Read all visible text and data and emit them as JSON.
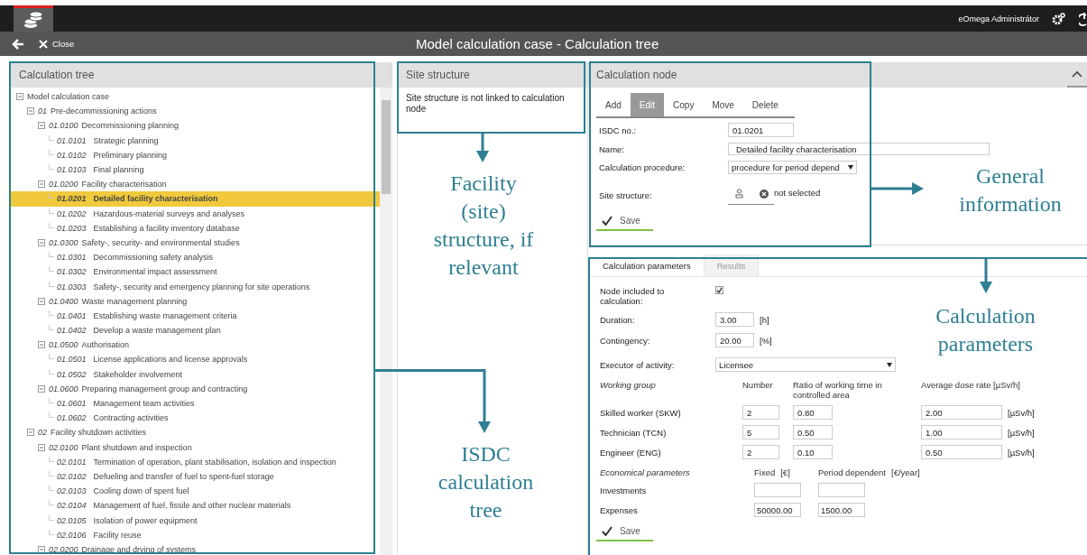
{
  "top_bar": {
    "user": "eOmega Administrátor"
  },
  "sub_bar": {
    "close": "Close",
    "title": "Model calculation case - Calculation tree"
  },
  "tree_panel": {
    "title": "Calculation tree",
    "root": {
      "label": "Model calculation case",
      "expanded": true,
      "selected": false,
      "children": [
        {
          "code": "01",
          "label": "Pre-decommissioning actions",
          "expanded": true,
          "selected": false,
          "children": [
            {
              "code": "01.0100",
              "label": "Decommissioning planning",
              "expanded": true,
              "selected": false,
              "children": [
                {
                  "code": "01.0101",
                  "label": "Strategic planning",
                  "selected": false
                },
                {
                  "code": "01.0102",
                  "label": "Preliminary planning",
                  "selected": false
                },
                {
                  "code": "01.0103",
                  "label": "Final planning",
                  "selected": false
                }
              ]
            },
            {
              "code": "01.0200",
              "label": "Facility characterisation",
              "expanded": true,
              "selected": false,
              "children": [
                {
                  "code": "01.0201",
                  "label": "Detailed facility characterisation",
                  "selected": true
                },
                {
                  "code": "01.0202",
                  "label": "Hazardous-material surveys and analyses",
                  "selected": false
                },
                {
                  "code": "01.0203",
                  "label": "Establishing a facility inventory database",
                  "selected": false
                }
              ]
            },
            {
              "code": "01.0300",
              "label": "Safety-, security- and environmental studies",
              "expanded": true,
              "selected": false,
              "children": [
                {
                  "code": "01.0301",
                  "label": "Decommissioning safety analysis",
                  "selected": false
                },
                {
                  "code": "01.0302",
                  "label": "Environmental impact assessment",
                  "selected": false
                },
                {
                  "code": "01.0303",
                  "label": "Safety-, security and emergency planning for site operations",
                  "selected": false
                }
              ]
            },
            {
              "code": "01.0400",
              "label": "Waste management planning",
              "expanded": true,
              "selected": false,
              "children": [
                {
                  "code": "01.0401",
                  "label": "Establishing waste management criteria",
                  "selected": false
                },
                {
                  "code": "01.0402",
                  "label": "Develop a waste management plan",
                  "selected": false
                }
              ]
            },
            {
              "code": "01.0500",
              "label": "Authorisation",
              "expanded": true,
              "selected": false,
              "children": [
                {
                  "code": "01.0501",
                  "label": "License applications and license approvals",
                  "selected": false
                },
                {
                  "code": "01.0502",
                  "label": "Stakeholder involvement",
                  "selected": false
                }
              ]
            },
            {
              "code": "01.0600",
              "label": "Preparing management group and contracting",
              "expanded": true,
              "selected": false,
              "children": [
                {
                  "code": "01.0601",
                  "label": "Management team activities",
                  "selected": false
                },
                {
                  "code": "01.0602",
                  "label": "Contracting activities",
                  "selected": false
                }
              ]
            }
          ]
        },
        {
          "code": "02",
          "label": "Facility shutdown activities",
          "expanded": true,
          "selected": false,
          "children": [
            {
              "code": "02.0100",
              "label": "Plant shutdown and inspection",
              "expanded": true,
              "selected": false,
              "children": [
                {
                  "code": "02.0101",
                  "label": "Termination of operation, plant stabilisation, isolation and inspection",
                  "selected": false
                },
                {
                  "code": "02.0102",
                  "label": "Defueling and transfer of fuel to spent-fuel storage",
                  "selected": false
                },
                {
                  "code": "02.0103",
                  "label": "Cooling down of spent fuel",
                  "selected": false
                },
                {
                  "code": "02.0104",
                  "label": "Management of fuel, fissile and other nuclear materials",
                  "selected": false
                },
                {
                  "code": "02.0105",
                  "label": "Isolation of power equipment",
                  "selected": false
                },
                {
                  "code": "02.0106",
                  "label": "Facility reuse",
                  "selected": false
                }
              ]
            },
            {
              "code": "02.0200",
              "label": "Drainage and drying of systems",
              "expanded": true,
              "selected": false
            }
          ]
        }
      ]
    }
  },
  "site_panel": {
    "title": "Site structure",
    "message": "Site structure is not linked to calculation node"
  },
  "node_panel": {
    "title": "Calculation node",
    "tabs": [
      {
        "label": "Add",
        "selected": false
      },
      {
        "label": "Edit",
        "selected": true
      },
      {
        "label": "Copy",
        "selected": false
      },
      {
        "label": "Move",
        "selected": false
      },
      {
        "label": "Delete",
        "selected": false
      }
    ],
    "isdc": {
      "label": "ISDC no.:",
      "value": "01.0201"
    },
    "name": {
      "label": "Name:",
      "value": "Detailed facility characterisation"
    },
    "procedure": {
      "label": "Calculation procedure:",
      "value": "procedure for period depend"
    },
    "site_structure": {
      "label": "Site structure:",
      "value": "not selected"
    },
    "save": "Save"
  },
  "params_panel": {
    "tabs": [
      {
        "label": "Calculation parameters",
        "selected": true
      },
      {
        "label": "Results",
        "selected": false
      }
    ],
    "included": {
      "label": "Node included to calculation:",
      "checked": true
    },
    "duration": {
      "label": "Duration:",
      "value": "3.00",
      "unit": "[h]"
    },
    "contingency": {
      "label": "Contingency:",
      "value": "20.00",
      "unit": "[%]"
    },
    "executor": {
      "label": "Executor of activity:",
      "value": "Licensee"
    },
    "working_group": {
      "columns": [
        "Working group",
        "Number",
        "Ratio of working time in controlled area",
        "Average dose rate [µSv/h]"
      ],
      "rows": [
        {
          "label": "Skilled worker (SKW)",
          "number": "2",
          "ratio": "0.80",
          "dose": "2.00",
          "unit": "[µSv/h]"
        },
        {
          "label": "Technician (TCN)",
          "number": "5",
          "ratio": "0.50",
          "dose": "1.00",
          "unit": "[µSv/h]"
        },
        {
          "label": "Engineer (ENG)",
          "number": "2",
          "ratio": "0.10",
          "dose": "0.50",
          "unit": "[µSv/h]"
        }
      ]
    },
    "economical": {
      "title": "Economical parameters",
      "fixed": "Fixed",
      "fixed_unit": "[€]",
      "period": "Period dependent",
      "period_unit": "[€/year]",
      "rows": [
        {
          "label": "Investments",
          "fixed": "",
          "period": ""
        },
        {
          "label": "Expenses",
          "fixed": "50000.00",
          "period": "1500.00"
        }
      ]
    },
    "save": "Save"
  },
  "annotations": [
    {
      "text": "Facility (site) structure, if relevant"
    },
    {
      "text": "General information"
    },
    {
      "text": "Calculation parameters"
    },
    {
      "text": "ISDC calculation tree"
    }
  ]
}
